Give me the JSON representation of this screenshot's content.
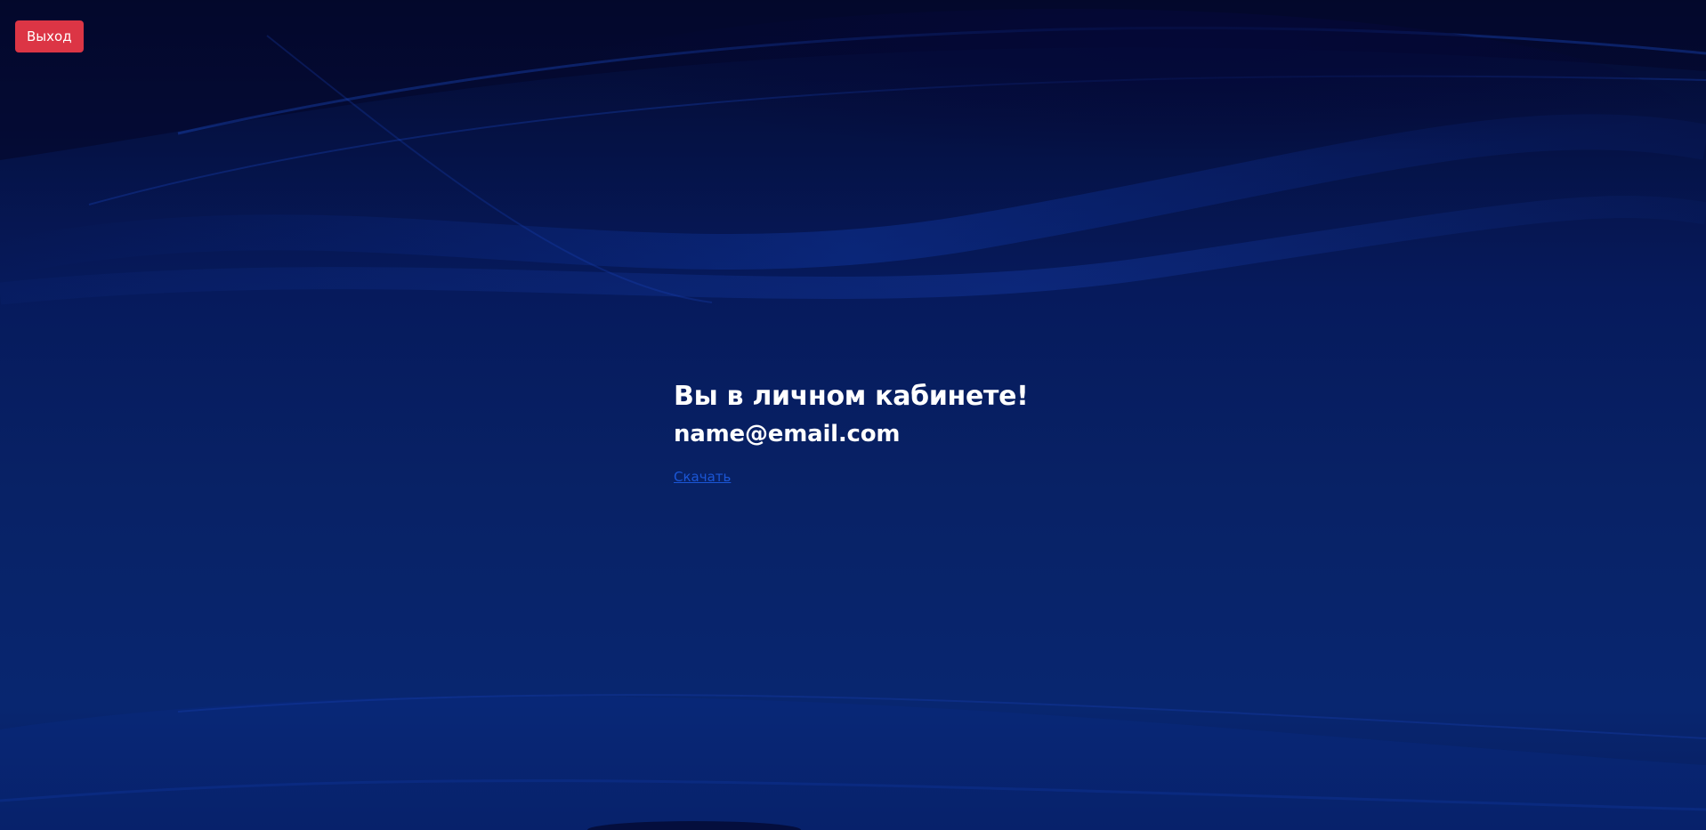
{
  "header": {
    "logout_label": "Выход"
  },
  "main": {
    "title": "Вы в личном кабинете!",
    "email": "name@email.com",
    "download_label": "Скачать"
  },
  "colors": {
    "background": "#061a5c",
    "logout_button": "#dc3545",
    "link": "#1b56d6",
    "text": "#ffffff"
  }
}
